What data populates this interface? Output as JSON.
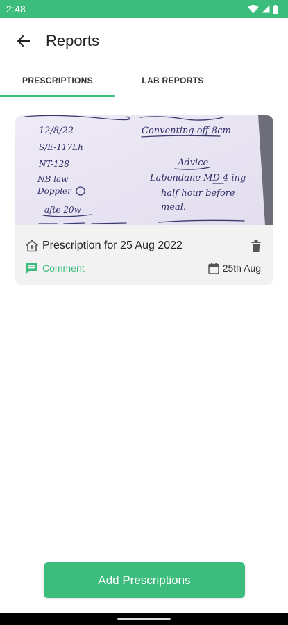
{
  "status_bar": {
    "time": "2:48",
    "icons": [
      "wifi-icon",
      "signal-icon",
      "battery-icon"
    ]
  },
  "app_bar": {
    "title": "Reports",
    "back_icon": "arrow-back-icon"
  },
  "tabs": [
    {
      "label": "PRESCRIPTIONS",
      "active": true
    },
    {
      "label": "LAB REPORTS",
      "active": false
    }
  ],
  "reports": [
    {
      "title": "Prescription for 25 Aug 2022",
      "comment_label": "Comment",
      "date": "25th Aug",
      "icons": [
        "hospital-icon",
        "delete-icon",
        "comment-icon",
        "calendar-icon"
      ],
      "image_alt": "handwritten prescription photo",
      "image_handwriting": {
        "left": [
          "12/8/22",
          "S/E-117Lh",
          "NT-128",
          "NB law",
          "Doppler"
        ],
        "right": [
          "Conventing off 8cm",
          "Advice",
          "Labondane MD 4 ing",
          "half hour before",
          "meal."
        ]
      }
    }
  ],
  "add_button": {
    "label": "Add Prescriptions"
  },
  "colors": {
    "accent": "#3dbd7d",
    "card_bg": "#f2f2f2",
    "paper": "#e9e5f3",
    "ink": "#303068"
  }
}
